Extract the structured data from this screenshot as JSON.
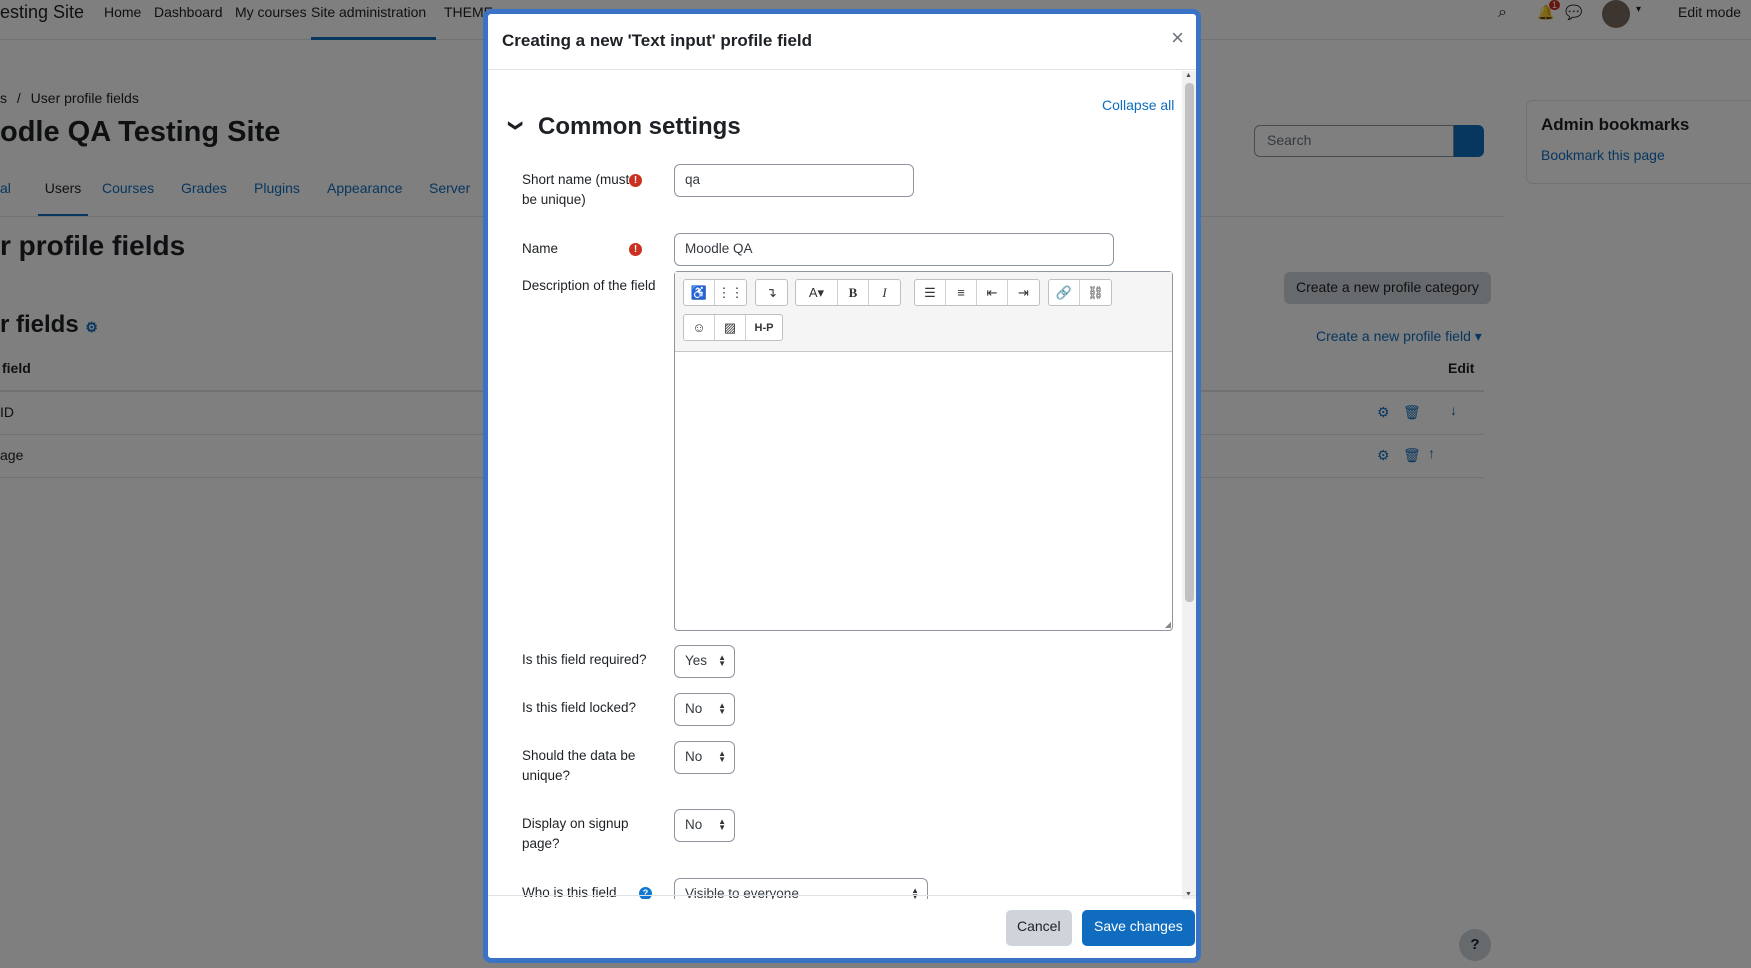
{
  "background": {
    "site_name": "esting Site",
    "nav": [
      "Home",
      "Dashboard",
      "My courses",
      "Site administration",
      "THEME"
    ],
    "edit_mode": "Edit mode",
    "notification_count": "1",
    "breadcrumb_prefix": "s",
    "breadcrumb_sep": "/",
    "breadcrumb_current": "User profile fields",
    "page_heading": "odle QA Testing Site",
    "tabs": [
      "al",
      "Users",
      "Courses",
      "Grades",
      "Plugins",
      "Appearance",
      "Server"
    ],
    "search_placeholder": "Search",
    "heading2": "r profile fields",
    "heading3": "r fields",
    "create_category": "Create a new profile category",
    "create_field": "Create a new profile field",
    "table_header_field": "field",
    "table_header_edit": "Edit",
    "rows": [
      "ID",
      "age"
    ],
    "bookmarks_title": "Admin bookmarks",
    "bookmarks_link": "Bookmark this page",
    "help": "?"
  },
  "modal": {
    "title": "Creating a new 'Text input' profile field",
    "close": "×",
    "collapse_all": "Collapse all",
    "section_title": "Common settings",
    "short_name_label": "Short name (must be unique)",
    "short_name_value": "qa",
    "name_label": "Name",
    "name_value": "Moodle QA",
    "description_label": "Description of the field",
    "toolbar_hp": "H-P",
    "required_label": "Is this field required?",
    "required_value": "Yes",
    "locked_label": "Is this field locked?",
    "locked_value": "No",
    "unique_label": "Should the data be unique?",
    "unique_value": "No",
    "signup_label": "Display on signup page?",
    "signup_value": "No",
    "visible_label": "Who is this field",
    "visible_value": "Visible to everyone",
    "cancel": "Cancel",
    "save": "Save changes"
  },
  "colors": {
    "primary": "#0f6cbf",
    "required": "#ca3120",
    "modal_border": "#3a73c6"
  }
}
